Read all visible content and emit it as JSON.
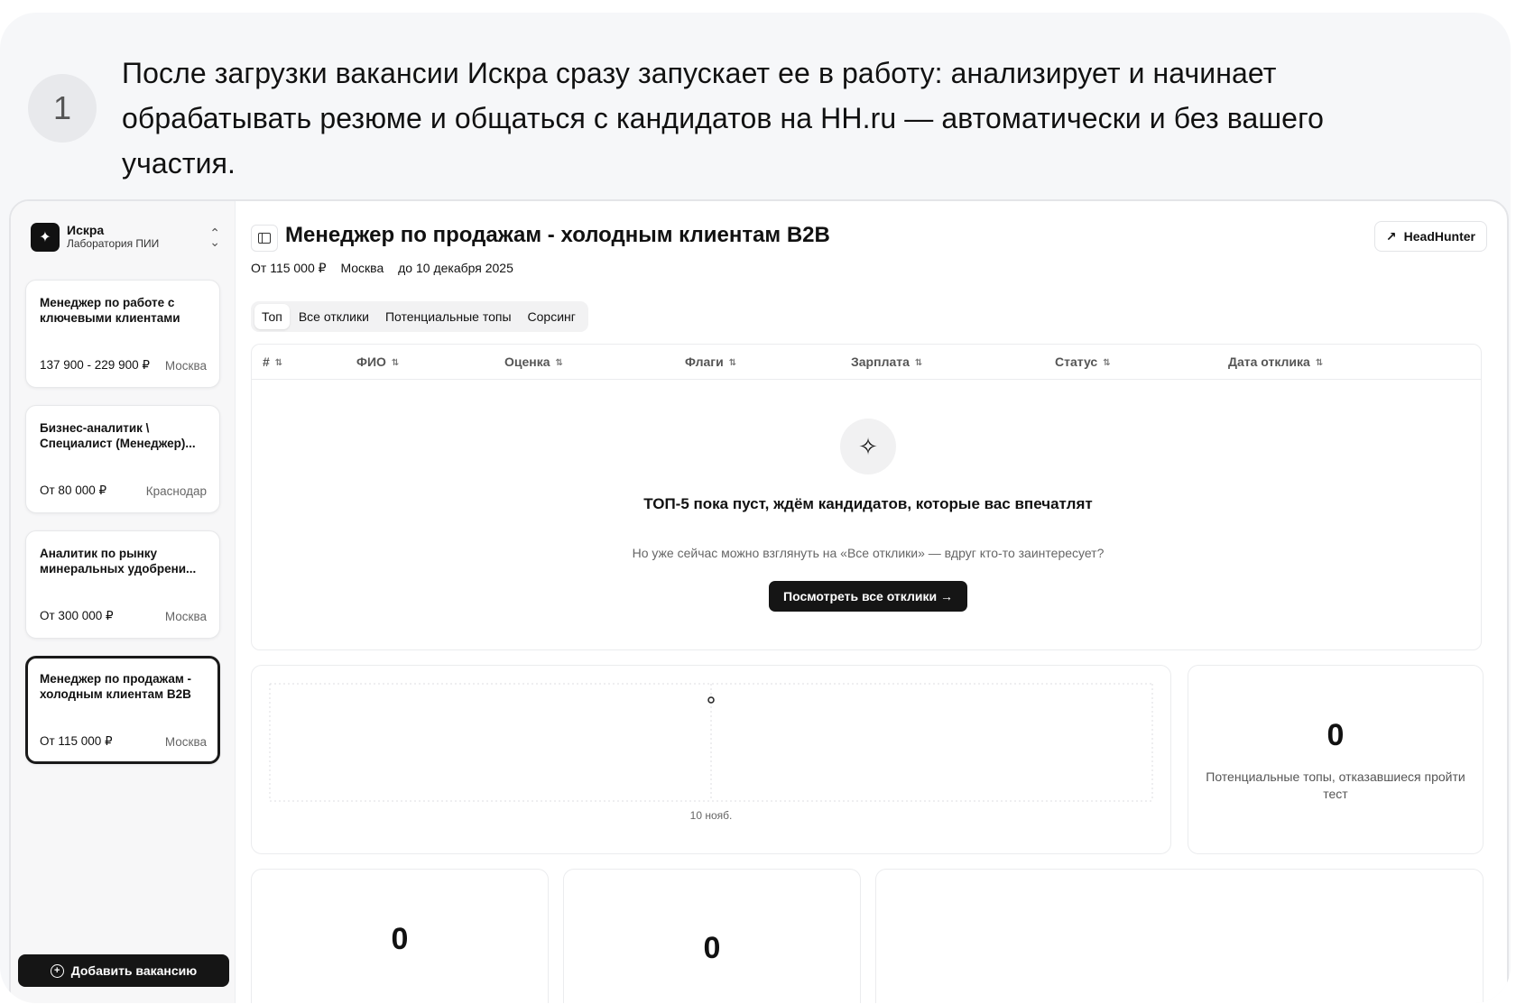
{
  "step": {
    "number": "1",
    "text": "После загрузки вакансии Искра сразу запускает ее в работу: анализирует и начинает обрабатывать резюме и общаться с кандидатов на HH.ru — автоматически и без вашего участия."
  },
  "sidebar": {
    "org_name": "Искра",
    "org_subtitle": "Лаборатория ПИИ",
    "vacancies": [
      {
        "title": "Менеджер по работе с ключевыми клиентами",
        "salary": "137 900 - 229 900 ₽",
        "city": "Москва"
      },
      {
        "title": "Бизнес-аналитик \\ Специалист (Менеджер)...",
        "salary": "От 80 000 ₽",
        "city": "Краснодар"
      },
      {
        "title": "Аналитик по рынку минеральных удобрени...",
        "salary": "От 300 000 ₽",
        "city": "Москва"
      },
      {
        "title": "Менеджер по продажам - холодным клиентам B2B",
        "salary": "От 115 000 ₽",
        "city": "Москва"
      }
    ],
    "add_button": "Добавить вакансию"
  },
  "header": {
    "title": "Менеджер по продажам - холодным клиентам B2B",
    "hh_button": "HeadHunter",
    "salary": "От 115 000 ₽",
    "city": "Москва",
    "deadline": "до 10 декабря 2025"
  },
  "tabs": [
    "Топ",
    "Все отклики",
    "Потенциальные топы",
    "Сорсинг"
  ],
  "table": {
    "columns": [
      "#",
      "ФИО",
      "Оценка",
      "Флаги",
      "Зарплата",
      "Статус",
      "Дата отклика"
    ]
  },
  "empty_state": {
    "title": "ТОП-5 пока пуст, ждём кандидатов, которые вас впечатлят",
    "subtitle": "Но уже сейчас можно взглянуть на «Все отклики» — вдруг кто-то заинтересует?",
    "button": "Посмотреть все отклики →"
  },
  "chart_data": {
    "type": "line",
    "x": [
      "10 нояб."
    ],
    "values": [
      0
    ],
    "grid": true
  },
  "stats": {
    "potential_refused": {
      "value": "0",
      "label": "Потенциальные топы, отказавшиеся пройти тест"
    },
    "card_a": {
      "value": "0"
    },
    "card_b": {
      "value": "0"
    }
  },
  "icons": [
    "logo-icon",
    "chevron-updown-icon",
    "sidebar-toggle-icon",
    "external-link-icon",
    "sparkles-icon",
    "arrow-right-icon",
    "plus-circle-icon",
    "sort-icon"
  ]
}
